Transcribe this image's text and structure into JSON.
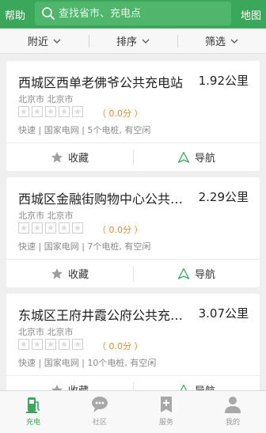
{
  "header": {
    "help_label": "帮助",
    "search_placeholder": "查找省市、充电点",
    "map_label": "地图"
  },
  "filters": [
    {
      "label": "附近"
    },
    {
      "label": "排序"
    },
    {
      "label": "筛选"
    }
  ],
  "stations": [
    {
      "name": "西城区西单老佛爷公共充电站",
      "distance": "1.92公里",
      "address": "北京市 北京市",
      "rating": 0,
      "score": "（ 0.0分 ）",
      "info": "快速 | 国家电网 | 5个电桩, 有空闲"
    },
    {
      "name": "西城区金融街购物中心公共充电站",
      "distance": "2.29公里",
      "address": "北京市 北京市",
      "rating": 0,
      "score": "（ 0.0分 ）",
      "info": "快速 | 国家电网 | 7个电桩, 有空闲"
    },
    {
      "name": "东城区王府井霞公府公共充电站",
      "distance": "3.07公里",
      "address": "北京市 北京市",
      "rating": 0,
      "score": "（ 0.0分 ）",
      "info": "快速 | 国家电网 | 10个电桩, 有空闲"
    }
  ],
  "card_actions": {
    "favorite_label": "收藏",
    "navigate_label": "导航"
  },
  "tabs": [
    {
      "label": "充电",
      "icon": "charging-station-icon"
    },
    {
      "label": "社区",
      "icon": "chat-bubble-icon"
    },
    {
      "label": "服务",
      "icon": "service-icon"
    },
    {
      "label": "我的",
      "icon": "person-icon"
    }
  ],
  "colors": {
    "brand": "#3aa75b",
    "score": "#ee8b2a",
    "background": "#efefef"
  }
}
